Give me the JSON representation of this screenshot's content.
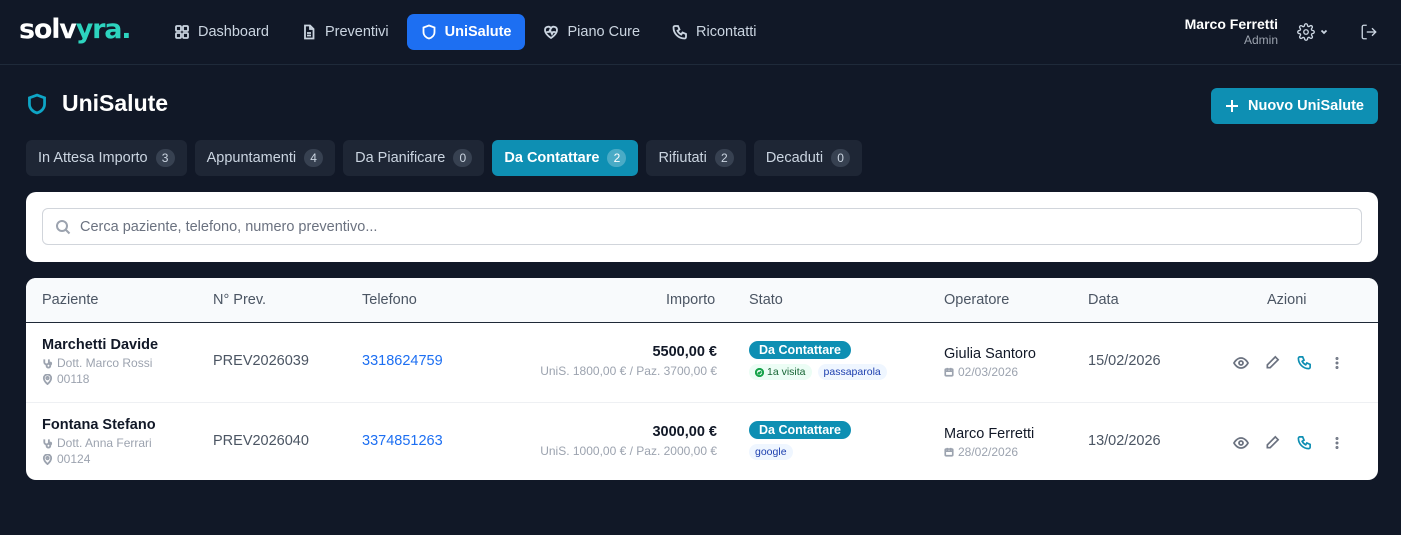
{
  "brand": {
    "logo_main": "solv",
    "logo_accent": "yra."
  },
  "nav": [
    {
      "label": "Dashboard",
      "icon": "grid-icon"
    },
    {
      "label": "Preventivi",
      "icon": "document-icon"
    },
    {
      "label": "UniSalute",
      "icon": "shield-icon",
      "active": true
    },
    {
      "label": "Piano Cure",
      "icon": "heart-pulse-icon"
    },
    {
      "label": "Ricontatti",
      "icon": "phone-icon"
    }
  ],
  "user": {
    "name": "Marco Ferretti",
    "role": "Admin"
  },
  "page": {
    "title": "UniSalute",
    "new_button": "Nuovo UniSalute"
  },
  "tabs": [
    {
      "label": "In Attesa Importo",
      "count": "3"
    },
    {
      "label": "Appuntamenti",
      "count": "4"
    },
    {
      "label": "Da Pianificare",
      "count": "0"
    },
    {
      "label": "Da Contattare",
      "count": "2",
      "active": true
    },
    {
      "label": "Rifiutati",
      "count": "2"
    },
    {
      "label": "Decaduti",
      "count": "0"
    }
  ],
  "search": {
    "placeholder": "Cerca paziente, telefono, numero preventivo..."
  },
  "table": {
    "columns": [
      "Paziente",
      "N° Prev.",
      "Telefono",
      "Importo",
      "Stato",
      "Operatore",
      "Data",
      "Azioni"
    ],
    "rows": [
      {
        "patient": "Marchetti Davide",
        "doctor": "Dott. Marco Rossi",
        "code": "00118",
        "prev": "PREV2026039",
        "phone": "3318624759",
        "amount": "5500,00 €",
        "amount_detail": "UniS. 1800,00 € / Paz. 3700,00 €",
        "status": "Da Contattare",
        "tag1": "1a visita",
        "tag2": "passaparola",
        "operator": "Giulia Santoro",
        "operator_date": "02/03/2026",
        "date": "15/02/2026"
      },
      {
        "patient": "Fontana Stefano",
        "doctor": "Dott. Anna Ferrari",
        "code": "00124",
        "prev": "PREV2026040",
        "phone": "3374851263",
        "amount": "3000,00 €",
        "amount_detail": "UniS. 1000,00 € / Paz. 2000,00 €",
        "status": "Da Contattare",
        "tag2": "google",
        "operator": "Marco Ferretti",
        "operator_date": "28/02/2026",
        "date": "13/02/2026"
      }
    ]
  },
  "colors": {
    "background": "#111827",
    "accent": "#0e8fb3",
    "nav_active": "#1d6ff2",
    "brand_accent": "#2dd4bf"
  }
}
